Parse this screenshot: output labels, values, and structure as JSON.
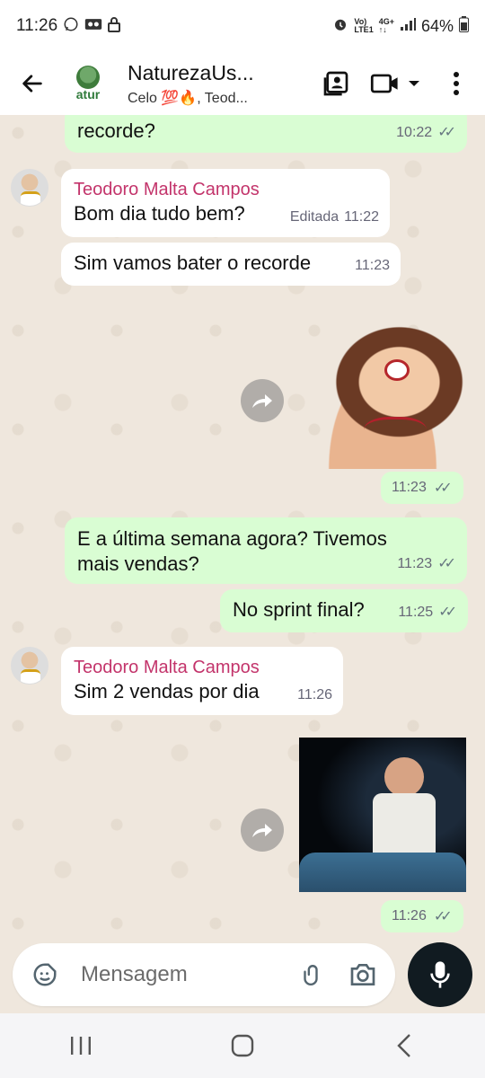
{
  "status_bar": {
    "time": "11:26",
    "battery": "64%",
    "network_vo": "Vo)",
    "network_lte": "LTE1",
    "network_4g": "4G+"
  },
  "header": {
    "group_name": "NaturezaUs...",
    "members": "Celo 💯🔥, Teod...",
    "avatar_brand": "atur"
  },
  "messages": {
    "m1": {
      "text": "recorde?",
      "time": "10:22"
    },
    "m2": {
      "sender": "Teodoro Malta Campos",
      "text": "Bom dia tudo bem?",
      "edited": "Editada",
      "time": "11:22"
    },
    "m3": {
      "text": "Sim vamos bater o recorde",
      "time": "11:23"
    },
    "m4": {
      "time": "11:23"
    },
    "m5": {
      "line1": "E a última semana agora? Tivemos",
      "line2": "mais vendas?",
      "time": "11:23"
    },
    "m6": {
      "text": "No sprint final?",
      "time": "11:25"
    },
    "m7": {
      "sender": "Teodoro Malta Campos",
      "text": "Sim 2 vendas por dia",
      "time": "11:26"
    },
    "m8": {
      "time": "11:26"
    }
  },
  "input": {
    "placeholder": "Mensagem"
  },
  "icons": {
    "back": "arrow-left-icon",
    "contacts": "contact-card-icon",
    "video": "video-camera-icon",
    "menu": "more-vertical-icon",
    "emoji": "sticker-icon",
    "attach": "paperclip-icon",
    "camera": "camera-icon",
    "mic": "microphone-icon",
    "forward": "forward-icon"
  },
  "colors": {
    "outgoing_bubble": "#d9fdd3",
    "incoming_bubble": "#ffffff",
    "sender_name": "#c3346b",
    "chat_bg": "#efe7dd",
    "mic_button": "#111b21"
  }
}
